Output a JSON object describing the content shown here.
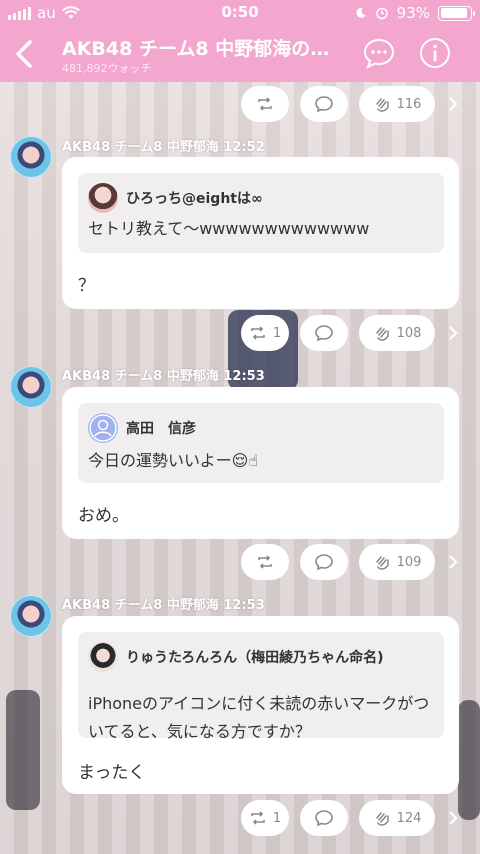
{
  "status_bar": {
    "carrier": "au",
    "time": "0:50",
    "battery": "93%",
    "battery_level": 0.93
  },
  "header": {
    "title": "AKB48 チーム8 中野郁海の…",
    "watch_count": "481,892ウォッチ"
  },
  "top_actions": {
    "retweet": "",
    "reaction_count": "116"
  },
  "posts": [
    {
      "author": "AKB48 チーム8 中野郁海",
      "time": "12:52",
      "quote_name": "ひろっち@eightは∞",
      "quote_text": "セトリ教えて〜wwwwwwwwwwwww",
      "reply": "？",
      "retweet_count": "1",
      "reaction_count": "108"
    },
    {
      "author": "AKB48 チーム8 中野郁海",
      "time": "12:53",
      "quote_name": "高田　信彦",
      "quote_text": "今日の運勢いいよー😌☝",
      "reply": "おめ。",
      "retweet_count": "",
      "reaction_count": "109"
    },
    {
      "author": "AKB48 チーム8 中野郁海",
      "time": "12:53",
      "quote_name": "りゅうたろんろん（梅田綾乃ちゃん命名)",
      "quote_text": "iPhoneのアイコンに付く未読の赤いマークがついてると、気になる方ですか？",
      "reply": "まったく",
      "retweet_count": "1",
      "reaction_count": "124"
    }
  ],
  "colors": {
    "header_pink": "#f3a7cf",
    "card_bg": "#ffffff",
    "quote_bg": "#f0eeee"
  }
}
